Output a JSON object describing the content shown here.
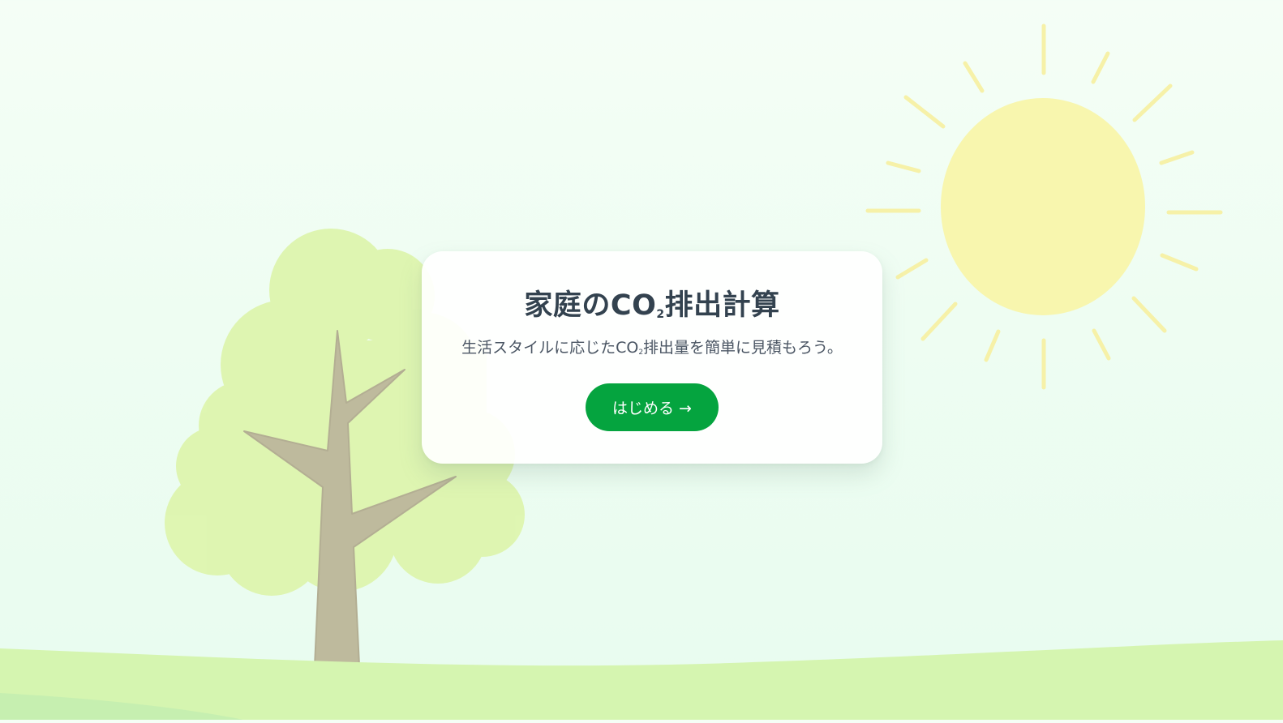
{
  "hero": {
    "title_main": "家庭のCO",
    "title_sub": "2",
    "title_end": "排出計算",
    "subtitle_start": "生活スタイルに応じたCO",
    "subtitle_sub": "2",
    "subtitle_end": "排出量を簡単に見積もろう。",
    "start_button_label": "はじめる →"
  },
  "colors": {
    "accent": "#05a43f",
    "sun": "#f6f3a8",
    "tree_foliage": "#dff5ad",
    "tree_trunk": "#bfbf9f",
    "ground": "#d4f5ae"
  }
}
